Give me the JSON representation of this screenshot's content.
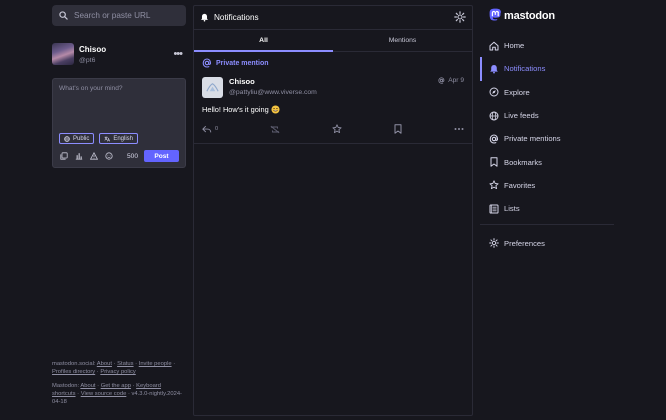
{
  "search": {
    "placeholder": "Search or paste URL"
  },
  "profile": {
    "display_name": "Chisoo",
    "handle": "@pt6"
  },
  "composer": {
    "placeholder": "What's on your mind?",
    "visibility": "Public",
    "language": "English",
    "char_count": "500",
    "post_label": "Post"
  },
  "footer": {
    "server_prefix": "mastodon.social:",
    "server_links": [
      "About",
      "Status",
      "Invite people",
      "Profiles directory",
      "Privacy policy"
    ],
    "mastodon_prefix": "Mastodon:",
    "mastodon_links": [
      "About",
      "Get the app",
      "Keyboard shortcuts",
      "View source code"
    ],
    "version": "v4.3.0-nightly.2024-04-18"
  },
  "column": {
    "title": "Notifications",
    "tabs": [
      {
        "label": "All",
        "active": true
      },
      {
        "label": "Mentions",
        "active": false
      }
    ]
  },
  "notification": {
    "type_label": "Private mention",
    "author_name": "Chisoo",
    "author_acct": "@pattyliu@www.viverse.com",
    "time": "Apr 9",
    "content": "Hello! How's it going",
    "reply_count": "0"
  },
  "brand": {
    "name": "mastodon",
    "accent": "#6364ff"
  },
  "nav": {
    "items": [
      {
        "label": "Home",
        "icon": "home-icon"
      },
      {
        "label": "Notifications",
        "icon": "bell-icon",
        "active": true
      },
      {
        "label": "Explore",
        "icon": "compass-icon"
      },
      {
        "label": "Live feeds",
        "icon": "globe-icon"
      },
      {
        "label": "Private mentions",
        "icon": "at-icon"
      },
      {
        "label": "Bookmarks",
        "icon": "bookmark-icon"
      },
      {
        "label": "Favorites",
        "icon": "star-icon"
      },
      {
        "label": "Lists",
        "icon": "list-icon"
      }
    ],
    "preferences_label": "Preferences"
  }
}
